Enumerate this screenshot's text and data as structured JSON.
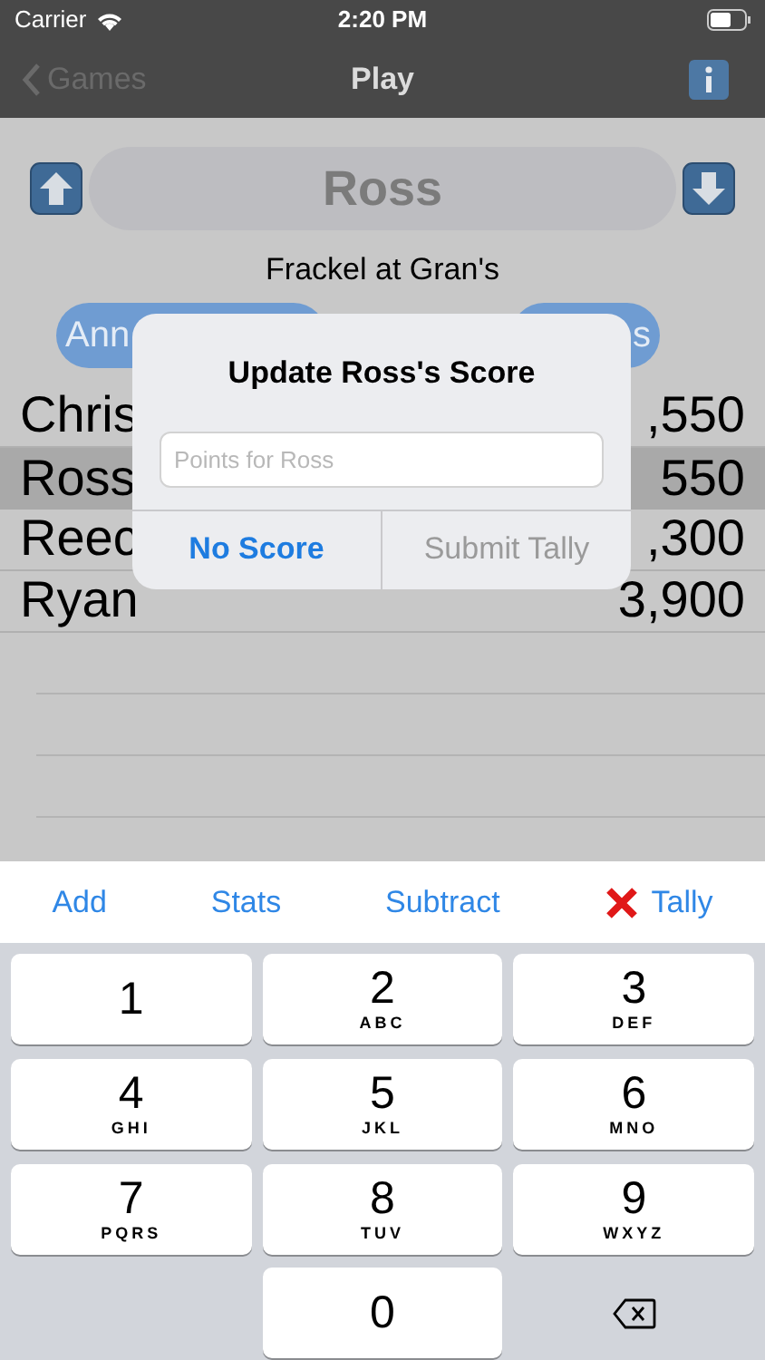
{
  "status_bar": {
    "carrier": "Carrier",
    "time": "2:20 PM"
  },
  "nav": {
    "back": "Games",
    "title": "Play"
  },
  "player": {
    "name": "Ross"
  },
  "game": {
    "title": "Frackel at Gran's"
  },
  "buttons": [
    {
      "label": "Ann"
    },
    {
      "label": "s"
    }
  ],
  "scores": [
    {
      "name": "Chris",
      "score": ",550",
      "selected": false
    },
    {
      "name": "Ross",
      "score": "550",
      "selected": true
    },
    {
      "name": "Reec",
      "score": ",300",
      "selected": false
    },
    {
      "name": "Ryan",
      "score": "3,900",
      "selected": false
    }
  ],
  "alert": {
    "title": "Update Ross's Score",
    "placeholder": "Points for Ross",
    "actions": [
      {
        "label": "No Score",
        "disabled": false
      },
      {
        "label": "Submit Tally",
        "disabled": true
      }
    ]
  },
  "toolbar": [
    {
      "label": "Add",
      "kind": "text"
    },
    {
      "label": "Stats",
      "kind": "text"
    },
    {
      "label": "Subtract",
      "kind": "text"
    },
    {
      "label": "Tally",
      "kind": "cross"
    }
  ],
  "keys": [
    {
      "kind": "digit",
      "digit": "1"
    },
    {
      "kind": "digit",
      "digit": "2",
      "letters": "ABC"
    },
    {
      "kind": "digit",
      "digit": "3",
      "letters": "DEF"
    },
    {
      "kind": "digit",
      "digit": "4",
      "letters": "GHI"
    },
    {
      "kind": "digit",
      "digit": "5",
      "letters": "JKL"
    },
    {
      "kind": "digit",
      "digit": "6",
      "letters": "MNO"
    },
    {
      "kind": "digit",
      "digit": "7",
      "letters": "PQRS"
    },
    {
      "kind": "digit",
      "digit": "8",
      "letters": "TUV"
    },
    {
      "kind": "digit",
      "digit": "9",
      "letters": "WXYZ"
    },
    {
      "kind": "blank"
    },
    {
      "kind": "digit",
      "digit": "0"
    },
    {
      "kind": "delete"
    }
  ]
}
